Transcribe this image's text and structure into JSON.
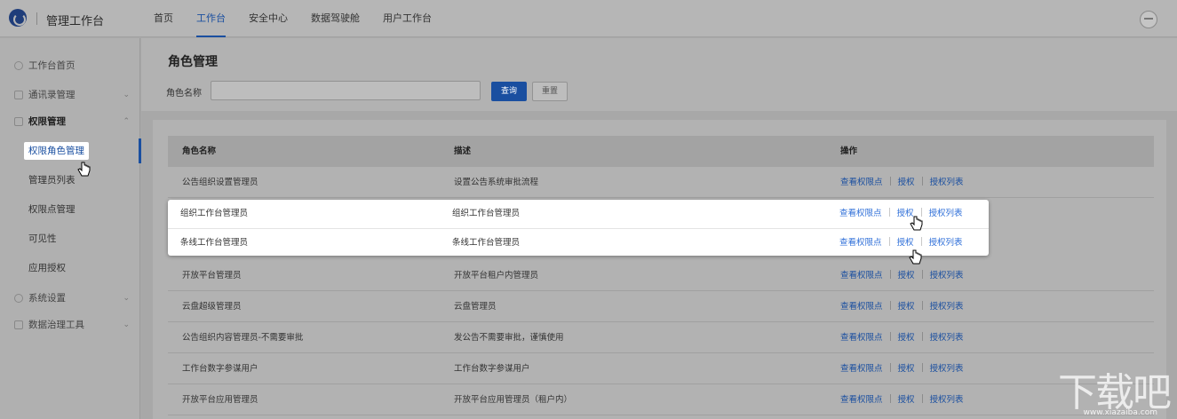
{
  "app": {
    "brand": "管理工作台"
  },
  "nav": {
    "items": [
      "首页",
      "工作台",
      "安全中心",
      "数据驾驶舱",
      "用户工作台"
    ],
    "active_index": 1
  },
  "sidebar": {
    "items": [
      {
        "label": "工作台首页",
        "icon": "dashboard-icon"
      },
      {
        "label": "通讯录管理",
        "icon": "org-tree-icon",
        "chevron": "⌄"
      },
      {
        "label": "权限管理",
        "icon": "grid-icon",
        "chevron": "⌃"
      },
      {
        "label": "系统设置",
        "icon": "gear-icon",
        "chevron": "⌄"
      },
      {
        "label": "数据治理工具",
        "icon": "database-icon",
        "chevron": "⌄"
      }
    ],
    "sub_items": [
      "权限角色管理",
      "管理员列表",
      "权限点管理",
      "可见性",
      "应用授权"
    ],
    "active_sub": 0
  },
  "page": {
    "title": "角色管理",
    "filter_label": "角色名称",
    "filter_placeholder": "",
    "query_button": "查询",
    "reset_button": "重置"
  },
  "table": {
    "columns": [
      "角色名称",
      "描述",
      "操作"
    ],
    "op_labels": [
      "查看权限点",
      "授权",
      "授权列表"
    ],
    "rows": [
      {
        "name": "公告组织设置管理员",
        "desc": "设置公告系统审批流程"
      },
      {
        "name": "组织工作台管理员",
        "desc": "组织工作台管理员"
      },
      {
        "name": "条线工作台管理员",
        "desc": "条线工作台管理员"
      },
      {
        "name": "开放平台管理员",
        "desc": "开放平台租户内管理员"
      },
      {
        "name": "云盘超级管理员",
        "desc": "云盘管理员"
      },
      {
        "name": "公告组织内容管理员-不需要审批",
        "desc": "发公告不需要审批，谨慎使用"
      },
      {
        "name": "工作台数字参谋用户",
        "desc": "工作台数字参谋用户"
      },
      {
        "name": "开放平台应用管理员",
        "desc": "开放平台应用管理员（租户内）"
      }
    ],
    "highlighted_rows": [
      1,
      2
    ]
  },
  "watermark": {
    "main": "下载吧",
    "sub": "www.xiazaiba.com"
  }
}
